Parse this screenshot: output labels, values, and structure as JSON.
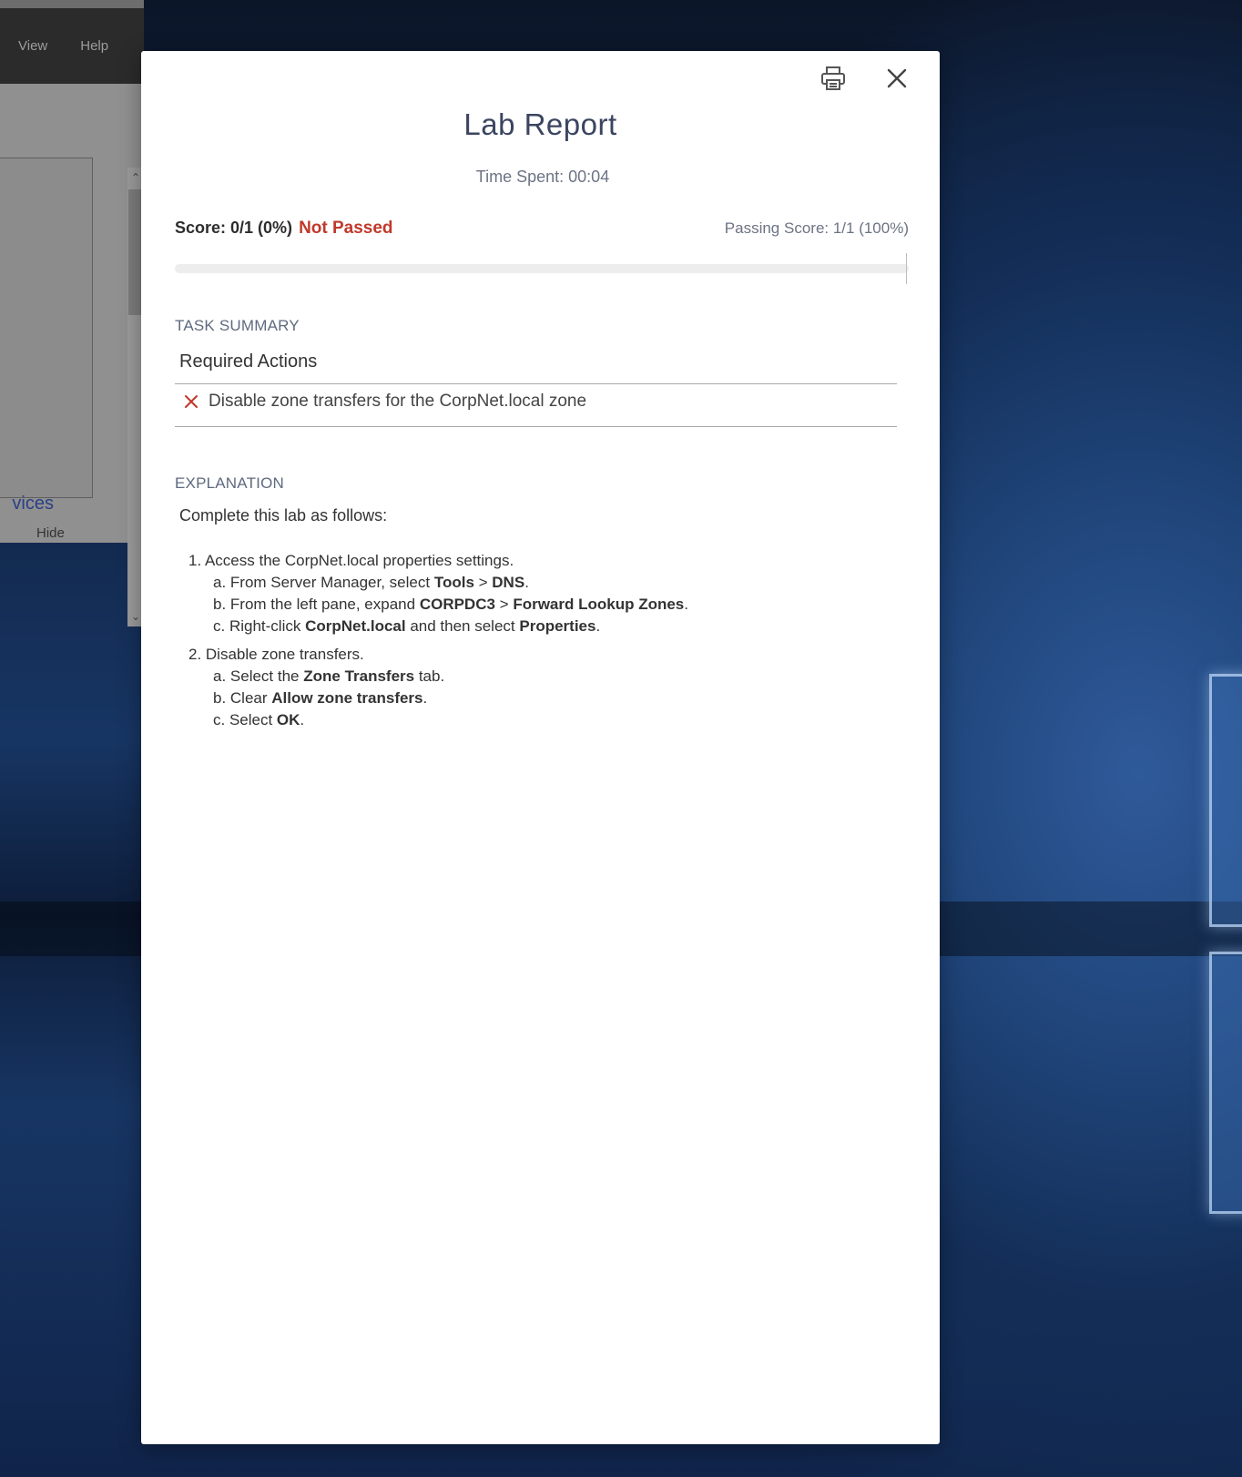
{
  "background_app": {
    "menu": [
      "View",
      "Help"
    ],
    "link_text": "vices",
    "hide_label": "Hide"
  },
  "modal": {
    "title": "Lab Report",
    "time_spent_label": "Time Spent:",
    "time_spent_value": "00:04",
    "score": "Score: 0/1 (0%)",
    "status": "Not Passed",
    "passing_score": "Passing Score: 1/1 (100%)",
    "progress_fraction": 0,
    "task_summary_label": "TASK SUMMARY",
    "required_actions_header": "Required Actions",
    "actions": [
      {
        "status": "failed",
        "text": "Disable zone transfers for the CorpNet.local zone"
      }
    ],
    "explanation_label": "EXPLANATION",
    "intro": "Complete this lab as follows:",
    "steps": [
      {
        "title": "1. Access the CorpNet.local properties settings.",
        "subs": [
          {
            "pre": "a. From Server Manager, select ",
            "b1": "Tools",
            "mid": " > ",
            "b2": "DNS",
            "post": "."
          },
          {
            "pre": "b. From the left pane, expand ",
            "b1": "CORPDC3",
            "mid": " > ",
            "b2": "Forward Lookup Zones",
            "post": "."
          },
          {
            "pre": "c. Right-click ",
            "b1": "CorpNet.local",
            "mid": " and then select ",
            "b2": "Properties",
            "post": "."
          }
        ]
      },
      {
        "title": "2. Disable zone transfers.",
        "subs": [
          {
            "pre": "a. Select the ",
            "b1": "Zone Transfers",
            "mid": " tab.",
            "b2": "",
            "post": ""
          },
          {
            "pre": "b. Clear ",
            "b1": "Allow zone transfers",
            "mid": ".",
            "b2": "",
            "post": ""
          },
          {
            "pre": "c. Select ",
            "b1": "OK",
            "mid": ".",
            "b2": "",
            "post": ""
          }
        ]
      }
    ],
    "icons": {
      "print": "printer-icon",
      "close": "close-icon",
      "failed": "x-icon"
    },
    "colors": {
      "status_fail": "#c0392b",
      "title": "#3b4560",
      "label": "#5e6a80"
    }
  }
}
